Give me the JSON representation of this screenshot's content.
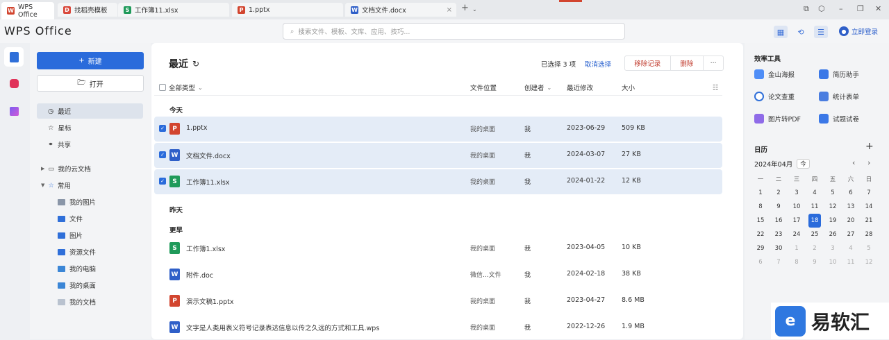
{
  "tabs": [
    {
      "label": "WPS Office",
      "type": "wps"
    },
    {
      "label": "找稻壳模板",
      "type": "docer"
    },
    {
      "label": "工作簿11.xlsx",
      "type": "S"
    },
    {
      "label": "1.pptx",
      "type": "P"
    },
    {
      "label": "文档文件.docx",
      "type": "W"
    }
  ],
  "colors": {
    "accent": "#2a6bdb",
    "ppt": "#d2452f",
    "word": "#2f5fc8",
    "sheet": "#1f9a5a"
  },
  "header": {
    "logo": "WPS Office",
    "search_placeholder": "搜索文件、模板、文库、应用、技巧...",
    "login": "立即登录"
  },
  "nav": {
    "new_label": "新建",
    "open_label": "打开",
    "items": [
      "最近",
      "星标",
      "共享"
    ],
    "cloud": "我的云文档",
    "common": "常用",
    "common_items": [
      "我的图片",
      "文件",
      "图片",
      "资源文件",
      "我的电脑",
      "我的桌面",
      "我的文档"
    ]
  },
  "main": {
    "title": "最近",
    "selected_info": "已选择 3 项",
    "cancel_select": "取消选择",
    "remove_record": "移除记录",
    "delete": "删除",
    "more": "···",
    "cols": {
      "type": "全部类型",
      "location": "文件位置",
      "creator": "创建者",
      "modified": "最近修改",
      "size": "大小"
    },
    "groups": {
      "today": "今天",
      "yesterday": "昨天",
      "earlier": "更早"
    },
    "today_files": [
      {
        "icon": "P",
        "name": "1.pptx",
        "location": "我的桌面",
        "creator": "我",
        "modified": "2023-06-29",
        "size": "509 KB",
        "checked": true
      },
      {
        "icon": "W",
        "name": "文档文件.docx",
        "location": "我的桌面",
        "creator": "我",
        "modified": "2024-03-07",
        "size": "27 KB",
        "checked": true
      },
      {
        "icon": "S",
        "name": "工作簿11.xlsx",
        "location": "我的桌面",
        "creator": "我",
        "modified": "2024-01-22",
        "size": "12 KB",
        "checked": true
      }
    ],
    "earlier_files": [
      {
        "icon": "S",
        "name": "工作簿1.xlsx",
        "location": "我的桌面",
        "creator": "我",
        "modified": "2023-04-05",
        "size": "10 KB"
      },
      {
        "icon": "W",
        "name": "附件.doc",
        "location": "微信...文件",
        "creator": "我",
        "modified": "2024-02-18",
        "size": "38 KB"
      },
      {
        "icon": "P",
        "name": "演示文稿1.pptx",
        "location": "我的桌面",
        "creator": "我",
        "modified": "2023-04-27",
        "size": "8.6 MB"
      },
      {
        "icon": "W",
        "name": "文字是人类用表义符号记录表达信息以传之久远的方式和工具.wps",
        "location": "我的桌面",
        "creator": "我",
        "modified": "2022-12-26",
        "size": "1.9 MB"
      }
    ]
  },
  "right": {
    "tools_title": "效率工具",
    "tools": [
      "金山海报",
      "简历助手",
      "论文查重",
      "统计表单",
      "图片转PDF",
      "试题试卷"
    ],
    "calendar_title": "日历",
    "month": "2024年04月",
    "today_btn": "今",
    "weekdays": [
      "一",
      "二",
      "三",
      "四",
      "五",
      "六",
      "日"
    ],
    "days": [
      [
        "1",
        "2",
        "3",
        "4",
        "5",
        "6",
        "7"
      ],
      [
        "8",
        "9",
        "10",
        "11",
        "12",
        "13",
        "14"
      ],
      [
        "15",
        "16",
        "17",
        "18",
        "19",
        "20",
        "21"
      ],
      [
        "22",
        "23",
        "24",
        "25",
        "26",
        "27",
        "28"
      ],
      [
        "29",
        "30",
        "1",
        "2",
        "3",
        "4",
        "5"
      ],
      [
        "6",
        "7",
        "8",
        "9",
        "10",
        "11",
        "12"
      ]
    ],
    "today": "18"
  },
  "watermark": "易软汇"
}
